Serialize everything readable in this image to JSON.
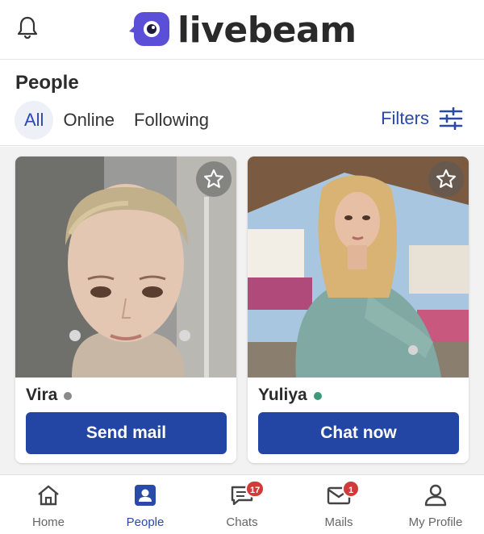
{
  "header": {
    "logo_text": "livebeam",
    "brand_color": "#5b4fd8",
    "notifications_icon": "bell-icon"
  },
  "people": {
    "title": "People",
    "tabs": [
      {
        "label": "All",
        "active": true
      },
      {
        "label": "Online",
        "active": false
      },
      {
        "label": "Following",
        "active": false
      }
    ],
    "filters_label": "Filters",
    "filters_icon": "sliders-icon"
  },
  "cards": [
    {
      "name": "Vira",
      "status_color": "#8a8a8a",
      "button_label": "Send mail",
      "favorite_icon": "star-outline-icon"
    },
    {
      "name": "Yuliya",
      "status_color": "#3a9a7a",
      "button_label": "Chat now",
      "favorite_icon": "star-outline-icon"
    }
  ],
  "bottom_nav": [
    {
      "label": "Home",
      "icon": "home-icon",
      "active": false,
      "badge": ""
    },
    {
      "label": "People",
      "icon": "person-card-icon",
      "active": true,
      "badge": ""
    },
    {
      "label": "Chats",
      "icon": "chat-icon",
      "active": false,
      "badge": "17"
    },
    {
      "label": "Mails",
      "icon": "mail-icon",
      "active": false,
      "badge": "1"
    },
    {
      "label": "My Profile",
      "icon": "profile-icon",
      "active": false,
      "badge": ""
    }
  ],
  "colors": {
    "accent": "#2a4aa8",
    "button": "#2346a5",
    "badge": "#d23a3a"
  }
}
